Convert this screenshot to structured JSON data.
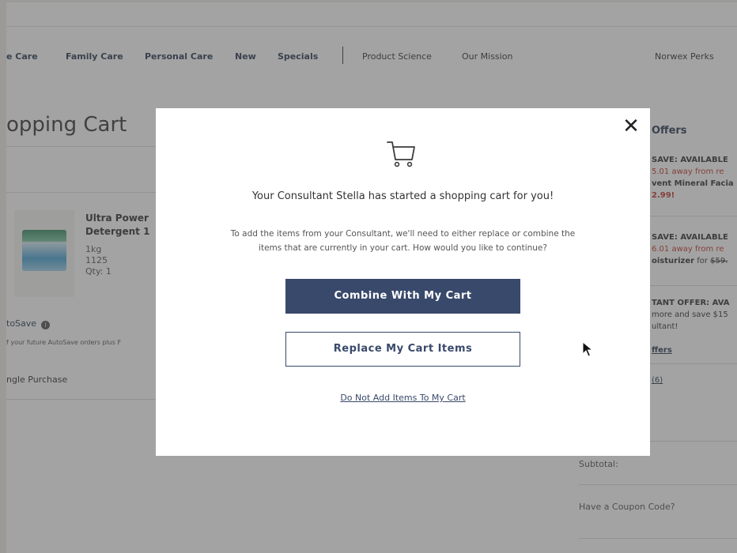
{
  "nav": {
    "items": [
      {
        "label": "e Care"
      },
      {
        "label": "Family Care"
      },
      {
        "label": "Personal Care"
      },
      {
        "label": "New"
      },
      {
        "label": "Specials"
      },
      {
        "label": "Product Science"
      },
      {
        "label": "Our Mission"
      },
      {
        "label": "Norwex Perks"
      }
    ]
  },
  "page": {
    "title": "opping Cart"
  },
  "product": {
    "name_line1": "Ultra Power",
    "name_line2": "Detergent 1",
    "size": "1kg",
    "code": "1125",
    "qty": "Qty: 1"
  },
  "purchase": {
    "autosave_label": "toSave",
    "autosave_desc": "f your future AutoSave orders plus F",
    "single_label": "ngle Purchase"
  },
  "sidebar": {
    "header": "Offers",
    "offer1": {
      "line1": "SAVE: AVAILABLE",
      "line2": "5.01 away from re",
      "line3": "vent Mineral Facia",
      "line4": "2.99!"
    },
    "offer2": {
      "line1": "SAVE: AVAILABLE",
      "line2": "6.01 away from re",
      "line3": "oisturizer for $59.",
      "line3_bold": "oisturizer",
      "line3_rest": " for ",
      "line3_price": "$59."
    },
    "offer3": {
      "line1": "TANT OFFER: AVA",
      "line2": "more and save $15",
      "line3": "ultant!"
    },
    "link1": "ffers",
    "link2": "(6)"
  },
  "summary": {
    "subtotal_label": "Subtotal:",
    "coupon_label": "Have a Coupon Code?"
  },
  "modal": {
    "title": "Your Consultant Stella has started a shopping cart for you!",
    "desc_line1": "To add the items from your Consultant, we'll need to either replace or combine the",
    "desc_line2": "items that are currently in your cart. How would you like to continue?",
    "combine_label": "Combine With My Cart",
    "replace_label": "Replace My Cart Items",
    "decline_label": "Do Not Add Items To My Cart",
    "close_glyph": "✕"
  },
  "colors": {
    "primary": "#39496b",
    "overlay": "rgba(72,72,72,0.50)",
    "sale_red": "#c0392b"
  },
  "icons": {
    "cart": "shopping-cart-icon",
    "close": "close-icon",
    "info": "info-icon",
    "cursor": "mouse-pointer-icon"
  }
}
